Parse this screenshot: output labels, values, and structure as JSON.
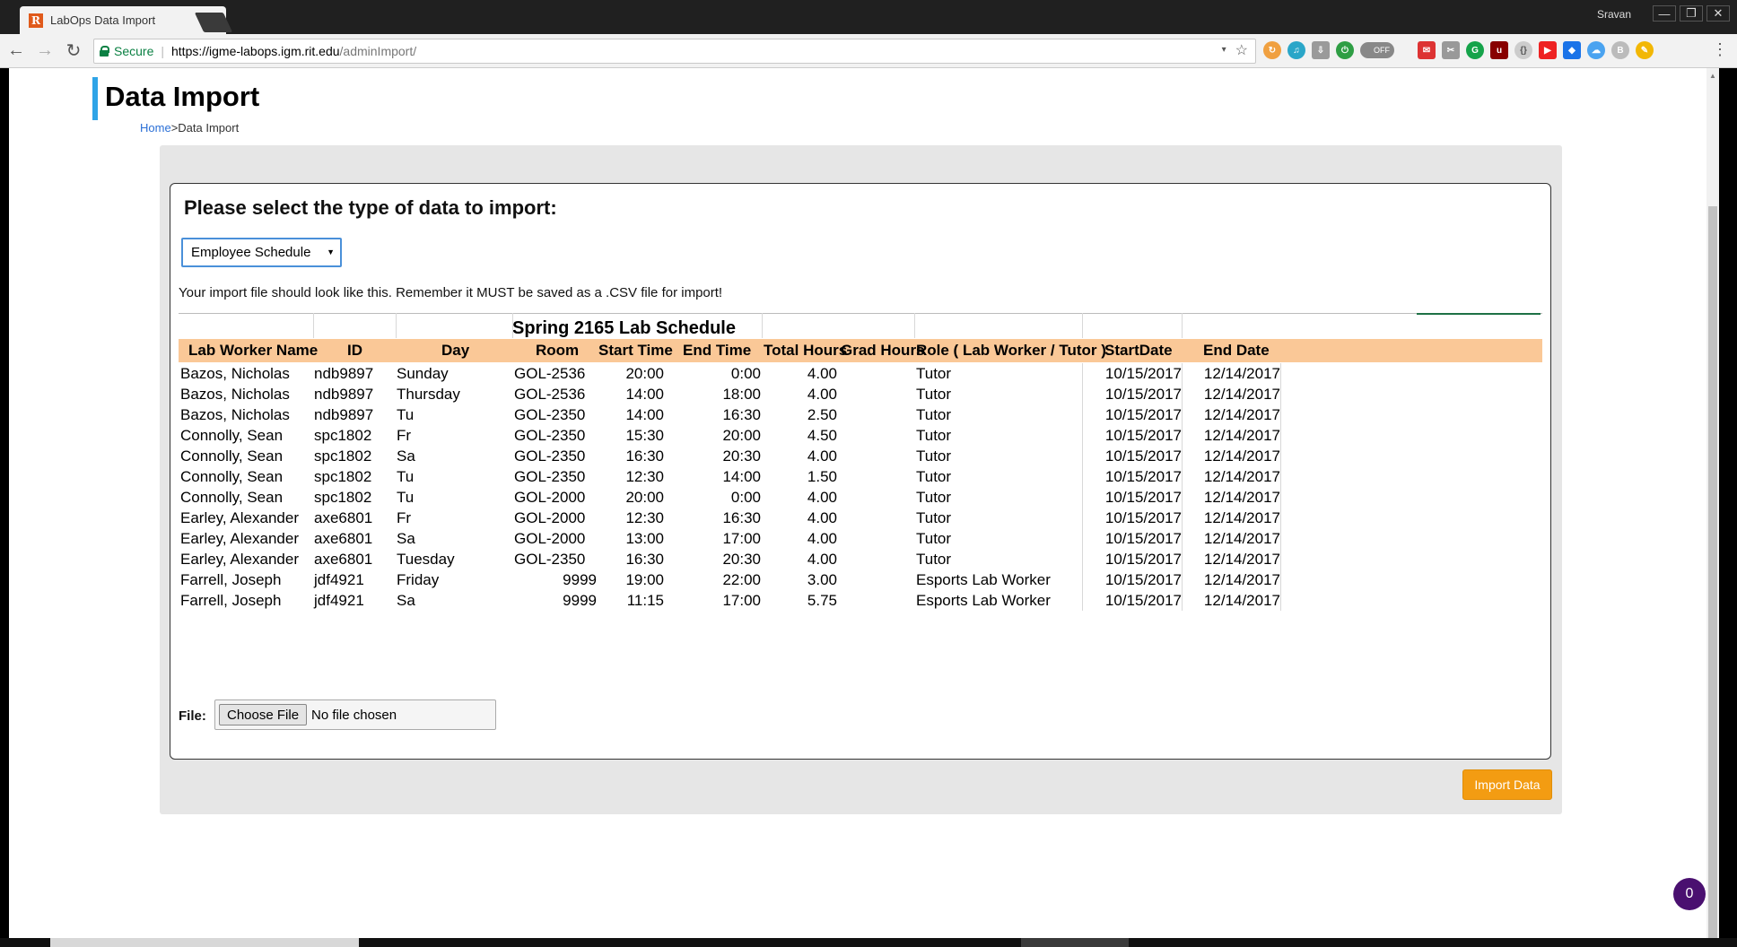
{
  "browser": {
    "tab_title": "LabOps Data Import",
    "tab_favicon": "R",
    "user": "Sravan",
    "secure_label": "Secure",
    "url_host": "https://igme-labops.igm.rit.edu",
    "url_path": "/adminImport/"
  },
  "page": {
    "title": "Data Import",
    "breadcrumb": {
      "home": "Home",
      "separator": ">",
      "current": "Data Import"
    }
  },
  "import_form": {
    "heading": "Please select the type of data to import:",
    "type_selected": "Employee Schedule",
    "hint": "Your import file should look like this. Remember it MUST be saved as a .CSV file for import!",
    "file_label": "File:",
    "choose_file": "Choose File",
    "no_file": "No file chosen",
    "submit": "Import Data"
  },
  "sample_sheet": {
    "title": "Spring 2165 Lab Schedule",
    "columns": [
      "Lab Worker Name",
      "ID",
      "Day",
      "Room",
      "Start Time",
      "End Time",
      "Total Hours",
      "Grad Hours",
      "Role ( Lab Worker / Tutor )",
      "StartDate",
      "End Date"
    ],
    "rows": [
      [
        "Bazos, Nicholas",
        "ndb9897",
        "Sunday",
        "GOL-2536",
        "20:00",
        "0:00",
        "4.00",
        "",
        "Tutor",
        "10/15/2017",
        "12/14/2017"
      ],
      [
        "Bazos, Nicholas",
        "ndb9897",
        "Thursday",
        "GOL-2536",
        "14:00",
        "18:00",
        "4.00",
        "",
        "Tutor",
        "10/15/2017",
        "12/14/2017"
      ],
      [
        "Bazos, Nicholas",
        "ndb9897",
        "Tu",
        "GOL-2350",
        "14:00",
        "16:30",
        "2.50",
        "",
        "Tutor",
        "10/15/2017",
        "12/14/2017"
      ],
      [
        "Connolly, Sean",
        "spc1802",
        "Fr",
        "GOL-2350",
        "15:30",
        "20:00",
        "4.50",
        "",
        "Tutor",
        "10/15/2017",
        "12/14/2017"
      ],
      [
        "Connolly, Sean",
        "spc1802",
        "Sa",
        "GOL-2350",
        "16:30",
        "20:30",
        "4.00",
        "",
        "Tutor",
        "10/15/2017",
        "12/14/2017"
      ],
      [
        "Connolly, Sean",
        "spc1802",
        "Tu",
        "GOL-2350",
        "12:30",
        "14:00",
        "1.50",
        "",
        "Tutor",
        "10/15/2017",
        "12/14/2017"
      ],
      [
        "Connolly, Sean",
        "spc1802",
        "Tu",
        "GOL-2000",
        "20:00",
        "0:00",
        "4.00",
        "",
        "Tutor",
        "10/15/2017",
        "12/14/2017"
      ],
      [
        "Earley, Alexander",
        "axe6801",
        "Fr",
        "GOL-2000",
        "12:30",
        "16:30",
        "4.00",
        "",
        "Tutor",
        "10/15/2017",
        "12/14/2017"
      ],
      [
        "Earley, Alexander",
        "axe6801",
        "Sa",
        "GOL-2000",
        "13:00",
        "17:00",
        "4.00",
        "",
        "Tutor",
        "10/15/2017",
        "12/14/2017"
      ],
      [
        "Earley, Alexander",
        "axe6801",
        "Tuesday",
        "GOL-2350",
        "16:30",
        "20:30",
        "4.00",
        "",
        "Tutor",
        "10/15/2017",
        "12/14/2017"
      ],
      [
        "Farrell, Joseph",
        "jdf4921",
        "Friday",
        "9999",
        "19:00",
        "22:00",
        "3.00",
        "",
        "Esports Lab Worker",
        "10/15/2017",
        "12/14/2017"
      ],
      [
        "Farrell, Joseph",
        "jdf4921",
        "Sa",
        "9999",
        "11:15",
        "17:00",
        "5.75",
        "",
        "Esports Lab Worker",
        "10/15/2017",
        "12/14/2017"
      ]
    ]
  },
  "chat": {
    "count": "0"
  },
  "colors": {
    "accent": "#2fa4e7",
    "header_fill": "#fac897",
    "import_button": "#f39c12",
    "chat": "#4a1070"
  }
}
